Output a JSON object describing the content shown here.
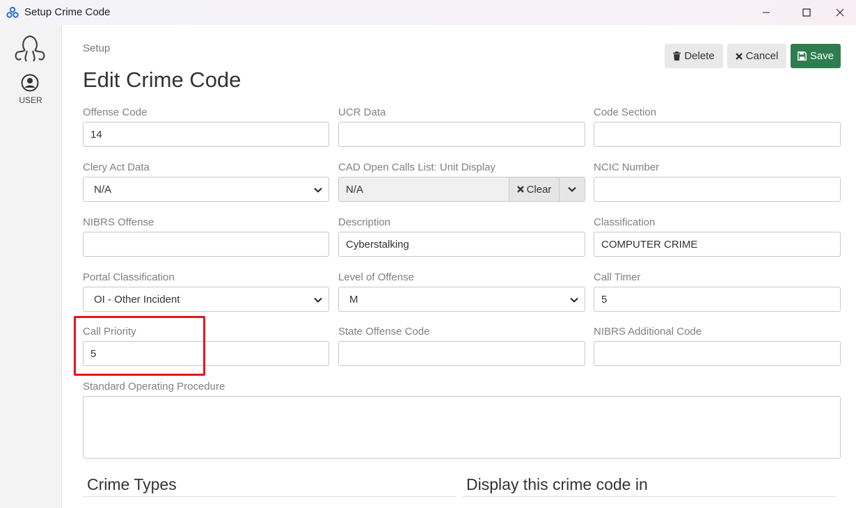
{
  "window": {
    "title": "Setup Crime Code"
  },
  "rail": {
    "user_label": "USER"
  },
  "header": {
    "breadcrumb": "Setup",
    "title": "Edit Crime Code",
    "delete_label": "Delete",
    "cancel_label": "Cancel",
    "save_label": "Save"
  },
  "colors": {
    "save": "#2e7d4f",
    "highlight": "#e8141b"
  },
  "fields": {
    "offense_code": {
      "label": "Offense Code",
      "value": "14"
    },
    "ucr_data": {
      "label": "UCR Data",
      "value": ""
    },
    "code_section": {
      "label": "Code Section",
      "value": ""
    },
    "clery_act_data": {
      "label": "Clery Act Data",
      "value": "N/A"
    },
    "cad_open_calls": {
      "label": "CAD Open Calls List: Unit Display",
      "value": "N/A",
      "clear_label": "Clear"
    },
    "ncic_number": {
      "label": "NCIC Number",
      "value": ""
    },
    "nibrs_offense": {
      "label": "NIBRS Offense",
      "value": ""
    },
    "description": {
      "label": "Description",
      "value": "Cyberstalking"
    },
    "classification": {
      "label": "Classification",
      "value": "COMPUTER CRIME"
    },
    "portal_classification": {
      "label": "Portal Classification",
      "value": "OI - Other Incident"
    },
    "level_of_offense": {
      "label": "Level of Offense",
      "value": "M"
    },
    "call_timer": {
      "label": "Call Timer",
      "value": "5"
    },
    "call_priority": {
      "label": "Call Priority",
      "value": "5"
    },
    "state_offense_code": {
      "label": "State Offense Code",
      "value": ""
    },
    "nibrs_additional_code": {
      "label": "NIBRS Additional Code",
      "value": ""
    },
    "sop": {
      "label": "Standard Operating Procedure",
      "value": ""
    }
  },
  "sections": {
    "crime_types": "Crime Types",
    "display_in": "Display this crime code in"
  }
}
